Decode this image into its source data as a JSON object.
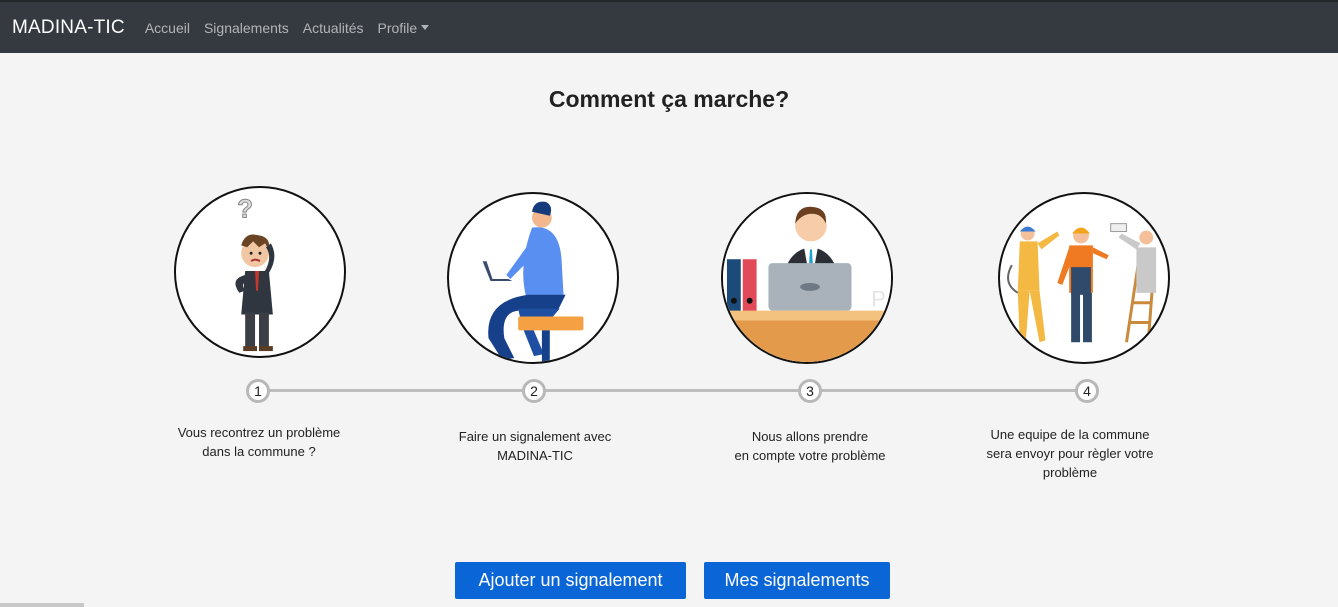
{
  "navbar": {
    "brand": "MADINA-TIC",
    "links": [
      "Accueil",
      "Signalements",
      "Actualités"
    ],
    "profile": "Profile"
  },
  "title": "Comment ça marche?",
  "steps": [
    {
      "number": "1",
      "text": "Vous recontrez un problème\ndans la commune ?",
      "illustration": "confused-man-icon"
    },
    {
      "number": "2",
      "text": "Faire un signalement avec\nMADINA-TIC",
      "illustration": "laptop-user-icon"
    },
    {
      "number": "3",
      "text": "Nous allons prendre\nen compte votre problème",
      "illustration": "office-worker-icon"
    },
    {
      "number": "4",
      "text": "Une equipe de la commune\nsera envoyr pour règler votre\nproblème",
      "illustration": "workers-team-icon"
    }
  ],
  "buttons": {
    "add": "Ajouter un signalement",
    "mine": "Mes signalements"
  },
  "colors": {
    "navbar": "#343a40",
    "primary": "#0a66d6",
    "background": "#f4f4f4"
  }
}
